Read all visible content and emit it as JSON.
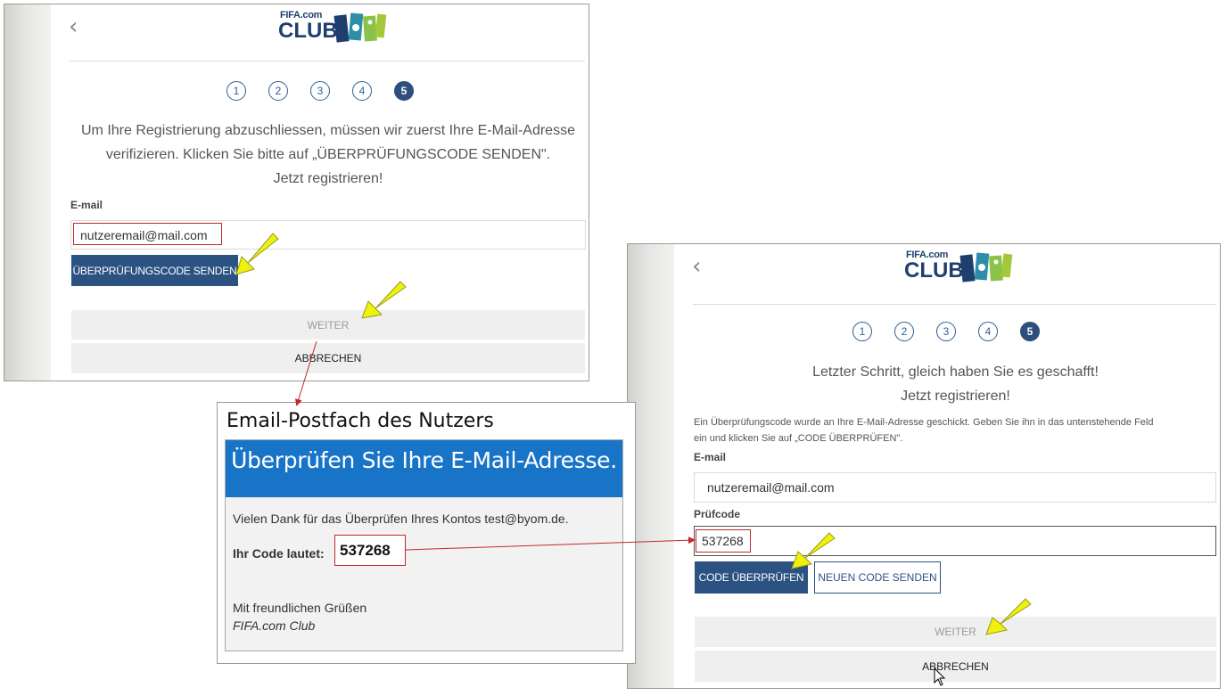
{
  "left_panel": {
    "back_icon": "chevron-left-icon",
    "logo": {
      "fifa": "FIFA.com",
      "club": "CLUB"
    },
    "steps": [
      "1",
      "2",
      "3",
      "4",
      "5"
    ],
    "active_step": "5",
    "intro_line1": "Um Ihre Registrierung abzuschliessen, müssen wir zuerst Ihre E-Mail-Adresse",
    "intro_line2": "verifizieren. Klicken Sie bitte auf „ÜBERPRÜFUNGSCODE SENDEN\".",
    "intro_line3": "Jetzt registrieren!",
    "email_label": "E-mail",
    "email_value": "nutzeremail@mail.com",
    "send_code_button": "ÜBERPRÜFUNGSCODE SENDEN",
    "weiter_button": "WEITER",
    "abbrechen_button": "ABBRECHEN"
  },
  "mail_box": {
    "caption": "Email-Postfach des Nutzers",
    "header": "Überprüfen Sie Ihre E-Mail-Adresse.",
    "thanks": "Vielen Dank für das Überprüfen Ihres Kontos test@byom.de.",
    "code_label": "Ihr Code lautet:",
    "code_value": "537268",
    "greeting": "Mit freundlichen Grüßen",
    "signature": "FIFA.com Club"
  },
  "right_panel": {
    "back_icon": "chevron-left-icon",
    "logo": {
      "fifa": "FIFA.com",
      "club": "CLUB"
    },
    "steps": [
      "1",
      "2",
      "3",
      "4",
      "5"
    ],
    "active_step": "5",
    "heading1": "Letzter Schritt, gleich haben Sie es geschafft!",
    "heading2": "Jetzt registrieren!",
    "info_line1": "Ein Überprüfungscode wurde an Ihre E-Mail-Adresse geschickt. Geben Sie ihn in das untenstehende Feld",
    "info_line2": "ein und klicken Sie auf „CODE ÜBERPRÜFEN\".",
    "email_label": "E-mail",
    "email_value": "nutzeremail@mail.com",
    "code_label": "Prüfcode",
    "code_value": "537268",
    "verify_button": "CODE ÜBERPRÜFEN",
    "new_code_button": "NEUEN CODE SENDEN",
    "weiter_button": "WEITER",
    "abbrechen_button": "ABBRECHEN"
  },
  "colors": {
    "primary_button": "#2c5282",
    "step_active": "#2c4f7c",
    "mail_header": "#1874c7",
    "highlight_arrow": "#eef20a",
    "annotation_red": "#c0282d"
  }
}
